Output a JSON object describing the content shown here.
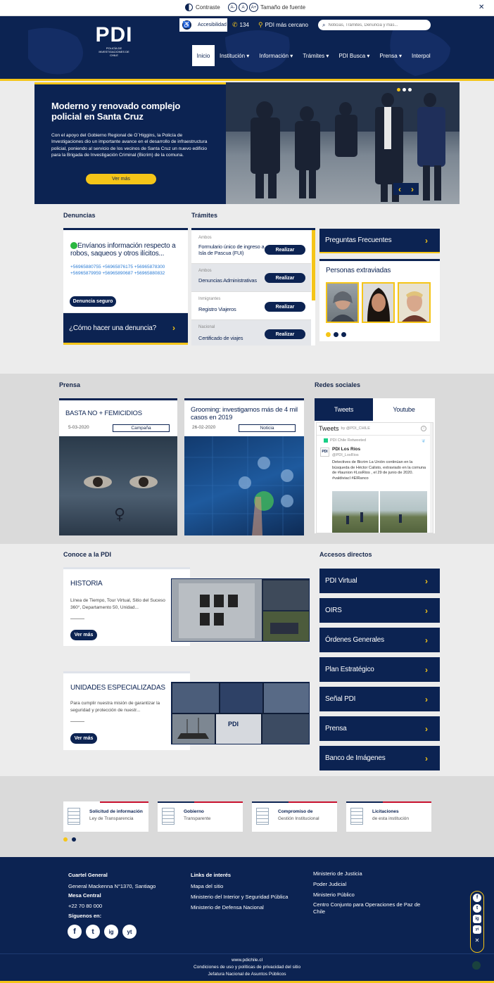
{
  "topbar": {
    "contrast_label": "Contraste",
    "font_size_label": "Tamaño de fuente",
    "font_a_minus": "A-",
    "font_a": "A",
    "font_a_plus": "A+",
    "close_glyph": "✕"
  },
  "header": {
    "logo_text": "PDI",
    "logo_sub": "POLICÍA DE INVESTIGACIONES DE CHILE",
    "accessibility_label": "Accesibilidad",
    "phone_label": "134",
    "nearest_label": "PDI más cercano",
    "search_placeholder": "Noticias, Trámites, Denuncia y más...",
    "nav": [
      {
        "label": "Inicio"
      },
      {
        "label": "Institución ▾"
      },
      {
        "label": "Información ▾"
      },
      {
        "label": "Trámites ▾"
      },
      {
        "label": "PDI Busca ▾"
      },
      {
        "label": "Prensa ▾"
      },
      {
        "label": "Interpol"
      }
    ]
  },
  "hero": {
    "title": "Moderno y renovado complejo policial en Santa Cruz",
    "body": "Con el apoyo del Gobierno Regional de O´Higgins, la Policía de Investigaciones dio un importante avance en el desarrollo de infraestructura policial, poniendo al servicio de los vecinos de Santa Cruz un nuevo edificio para la Brigada de Investigación Criminal (Bicrim) de la comuna.",
    "button": "Ver más",
    "prev_glyph": "‹",
    "next_glyph": "›"
  },
  "denuncias": {
    "heading": "Denuncias",
    "title": "Envíanos información respecto a robos, saqueos y otros ilícitos...",
    "phones": "+56965880755 +56965876175 +56965878300 +56965879959 +56965890687 +56965880832",
    "button": "Denuncia seguro",
    "how_label": "¿Cómo hacer una denuncia?",
    "arrow": "›"
  },
  "tramites": {
    "heading": "Trámites",
    "items": [
      {
        "category": "Ambos",
        "title": "Formulario único de ingreso a Isla de Pascua (FUI)",
        "button": "Realizar"
      },
      {
        "category": "Ambos",
        "title": "Denuncias Administrativas",
        "button": "Realizar"
      },
      {
        "category": "Inmigrantes",
        "title": "Registro Viajeros",
        "button": "Realizar"
      },
      {
        "category": "Nacional",
        "title": "Certificado de viajes",
        "button": "Realizar"
      }
    ]
  },
  "faq": {
    "label": "Preguntas Frecuentes",
    "arrow": "›"
  },
  "missing": {
    "heading": "Personas extraviadas"
  },
  "prensa": {
    "heading": "Prensa",
    "cards": [
      {
        "title": "BASTA NO + FEMICIDIOS",
        "date": "5-03-2020",
        "tag": "Campaña"
      },
      {
        "title": "Grooming: investigamos más de 4 mil casos en 2019",
        "date": "26-02-2020",
        "tag": "Noticia"
      }
    ]
  },
  "social": {
    "heading": "Redes sociales",
    "tabs": [
      {
        "label": "Tweets"
      },
      {
        "label": "Youtube"
      }
    ],
    "tweets_header": "Tweets",
    "tweets_by": "by @PDI_CHILE",
    "retweeted": "PDI Chile Retweeted",
    "account_name": "PDI Los Ríos",
    "account_handle": "@PDI_LosRios",
    "tweet_text": "Detectives de Bicrim La Unión continúan en la búsqueda de Héctor Calisto, extraviado en la comuna de #launion #LosRios , el 29 de junio de 2020. #valdiviacl #ElRanco"
  },
  "conoce": {
    "heading": "Conoce a la PDI",
    "cards": [
      {
        "title": "HISTORIA",
        "text": "Línea de Tiempo, Tour Virtual, Sitio del Suceso 360°, Departamento 50, Unidad...",
        "button": "Ver más"
      },
      {
        "title": "UNIDADES ESPECIALIZADAS",
        "text": "Para cumplir nuestra misión de garantizar la seguridad y protección de nuestr...",
        "button": "Ver más"
      }
    ]
  },
  "accesos": {
    "heading": "Accesos directos",
    "items": [
      {
        "label": "PDI Virtual"
      },
      {
        "label": "OIRS"
      },
      {
        "label": "Órdenes Generales"
      },
      {
        "label": "Plan Estratégico"
      },
      {
        "label": "Señal PDI"
      },
      {
        "label": "Prensa"
      },
      {
        "label": "Banco de Imágenes"
      }
    ],
    "arrow": "›"
  },
  "transparency": [
    {
      "title": "Solicitud de información",
      "subtitle": "Ley de Transparencia"
    },
    {
      "title": "Gobierno",
      "subtitle": "Transparente"
    },
    {
      "title": "Compromiso de",
      "subtitle": "Gestión Institucional"
    },
    {
      "title": "Licitaciones",
      "subtitle": "de esta institución"
    }
  ],
  "footer": {
    "hq_title": "Cuartel General",
    "hq_address": "General Mackenna N°1370, Santiago",
    "desk_title": "Mesa Central",
    "desk_phone": "+22 70 80 000",
    "follow": "Síguenos en:",
    "links_title": "Links de interés",
    "links": [
      "Mapa del sitio",
      "Ministerio del Interior y Seguridad Pública",
      "Ministerio de Defensa Nacional"
    ],
    "links2": [
      "Ministerio de Justicia",
      "Poder Judicial",
      "Ministerio Público",
      "Centro Conjunto para Operaciones de Paz de Chile"
    ],
    "site": "www.pdichile.cl",
    "conditions": "Condiciones de uso y políticas de privacidad del sitio",
    "office": "Jefatura Nacional de Asuntos Públicos",
    "social_icons": [
      "f",
      "t",
      "ig",
      "yt"
    ]
  },
  "colors": {
    "navy": "#0c2352",
    "gold": "#f5c518",
    "grey": "#ececec",
    "link": "#2a7bd4"
  }
}
